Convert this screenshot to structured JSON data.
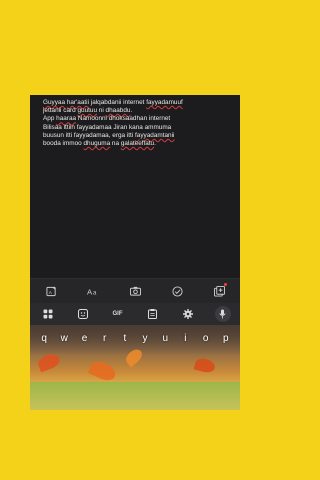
{
  "editor": {
    "lines": [
      {
        "id": "l1",
        "segments": [
          {
            "text": "Guyyaa",
            "spell": true
          },
          {
            "text": " ",
            "spell": false
          },
          {
            "text": "har'aatii",
            "spell": true
          },
          {
            "text": " jalqabdanii internet ",
            "spell": false
          },
          {
            "text": "fayyadamuuf",
            "spell": true
          }
        ]
      },
      {
        "id": "l2",
        "segments": [
          {
            "text": "jettanii card ",
            "spell": false
          },
          {
            "text": "guutuu",
            "spell": true
          },
          {
            "text": " ni ",
            "spell": false
          },
          {
            "text": "dhaabdu",
            "spell": true
          },
          {
            "text": ".",
            "spell": false
          }
        ]
      },
      {
        "id": "l3",
        "segments": [
          {
            "text": "App ",
            "spell": false
          },
          {
            "text": "haaraa",
            "spell": true
          },
          {
            "text": " Namoonni dhoksaadhan internet",
            "spell": false
          }
        ]
      },
      {
        "id": "l4",
        "segments": [
          {
            "text": "Bilisaa ittiin fayyadamaa Jiran kana ammuma",
            "spell": false
          }
        ]
      },
      {
        "id": "l5",
        "segments": [
          {
            "text": "buusun itti fayyadamaa, erga itti ",
            "spell": false
          },
          {
            "text": "fayyadamtanii",
            "spell": true
          }
        ]
      },
      {
        "id": "l6",
        "segments": [
          {
            "text": "booda immoo ",
            "spell": false
          },
          {
            "text": "dhuguma",
            "spell": true
          },
          {
            "text": " na ",
            "spell": false
          },
          {
            "text": "galateeffatu",
            "spell": true
          },
          {
            "text": ".",
            "spell": false
          }
        ]
      }
    ]
  },
  "format_bar": {
    "icons": [
      "ai-text-icon",
      "text-format-icon",
      "camera-icon",
      "checkmark-circle-icon",
      "image-add-icon"
    ]
  },
  "keyboard": {
    "toolbar": {
      "gif_label": "GIF",
      "icons": [
        "apps-grid-icon",
        "sticker-icon",
        "gif-icon",
        "clipboard-icon",
        "settings-gear-icon",
        "microphone-icon"
      ]
    },
    "rows": [
      [
        "q",
        "w",
        "e",
        "r",
        "t",
        "y",
        "u",
        "i",
        "o",
        "p"
      ]
    ]
  },
  "colors": {
    "background": "#f4d21a",
    "editor_bg": "#1c1c1e",
    "keyboard_bg": "#2b2b2d",
    "spellcheck": "#d43c3c",
    "notification_dot": "#e8453c"
  }
}
